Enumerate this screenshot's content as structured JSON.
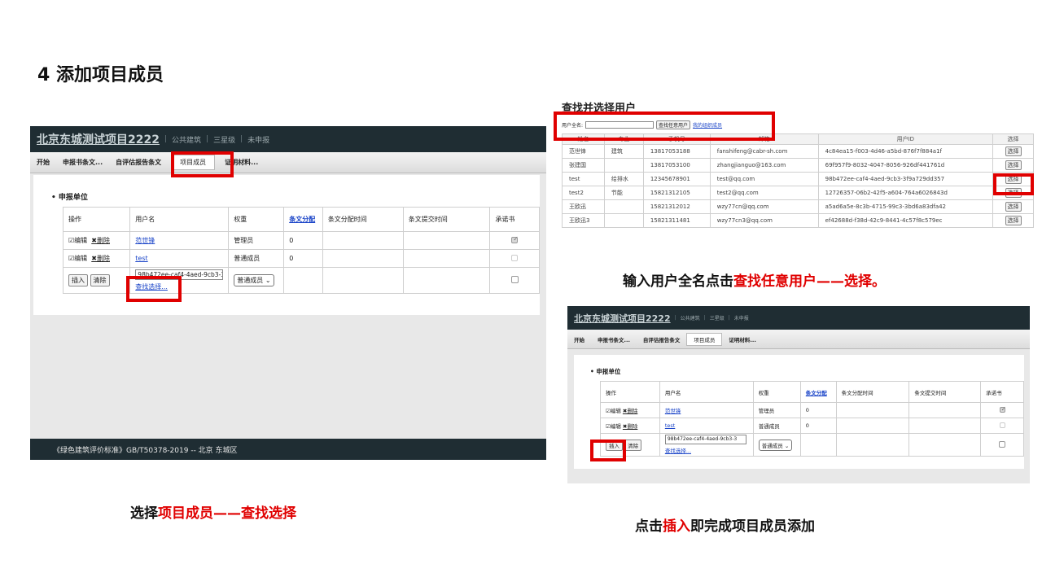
{
  "slide": {
    "title": "4 添加项目成员",
    "caption_left": {
      "p1": "选择",
      "p2": "项目成员——查找选择",
      "p3": ""
    },
    "caption_right_top": {
      "p1": "输入用户全名点击",
      "p2": "查找任意用户——选择。"
    },
    "caption_right_bottom": {
      "p1": "点击",
      "p2": "插入",
      "p3": "即完成项目成员添加"
    },
    "accent_color": "#e00000"
  },
  "app": {
    "project_name": "北京东城测试项目2222",
    "meta1": "公共建筑",
    "meta2": "三星级",
    "meta3": "未申报",
    "tabs": [
      "开始",
      "申报书条文...",
      "自评估报告条文",
      "项目成员",
      "证明材料..."
    ],
    "unit_label": "申报单位",
    "columns": [
      "操作",
      "用户名",
      "权重",
      "条文分配",
      "条文分配时间",
      "条文提交时间",
      "承诺书"
    ],
    "rows": [
      {
        "edit": "☑编辑",
        "del": "✖删除",
        "user": "范世锋",
        "role": "管理员",
        "count": "0"
      },
      {
        "edit": "☑编辑",
        "del": "✖删除",
        "user": "test",
        "role": "普通成员",
        "count": "0"
      }
    ],
    "insert_btn": "插入",
    "clear_btn": "清除",
    "user_id_value_left": "98b472ee-caf4-4aed-9cb3-3",
    "user_id_value_right": "98b472ee-caf4-4aed-9cb3-3",
    "find_link": "查找选择...",
    "role_select": "普通成员",
    "footer": "《绿色建筑评价标准》GB/T50378-2019 -- 北京 东城区"
  },
  "search": {
    "title": "查找并选择用户",
    "label": "用户全名:",
    "input_value": "",
    "find_btn": "查找任意用户",
    "my_org_link": "我的组织成员",
    "columns": [
      "姓名",
      "专业",
      "手机号",
      "邮箱",
      "用户ID",
      "选择"
    ],
    "rows": [
      {
        "name": "范世锋",
        "major": "建筑",
        "phone": "13817053188",
        "email": "fanshifeng@cabr-sh.com",
        "uid": "4c84ea15-f003-4d46-a5bd-876f7f884a1f",
        "pick": "选择"
      },
      {
        "name": "张建国",
        "major": "",
        "phone": "13817053100",
        "email": "zhangjianguo@163.com",
        "uid": "69f957f9-8032-4047-8056-926df441761d",
        "pick": "选择"
      },
      {
        "name": "test",
        "major": "给排水",
        "phone": "12345678901",
        "email": "test@qq.com",
        "uid": "98b472ee-caf4-4aed-9cb3-3f9a729dd357",
        "pick": "选择"
      },
      {
        "name": "test2",
        "major": "节能",
        "phone": "15821312105",
        "email": "test2@qq.com",
        "uid": "12726357-06b2-42f5-a604-764a6026843d",
        "pick": "选择"
      },
      {
        "name": "王欧迅",
        "major": "",
        "phone": "15821312012",
        "email": "wzy77cn@qq.com",
        "uid": "a5ad6a5e-8c3b-4715-99c3-3bd6a83dfa42",
        "pick": "选择"
      },
      {
        "name": "王欧迅3",
        "major": "",
        "phone": "15821311481",
        "email": "wzy77cn3@qq.com",
        "uid": "ef42688d-f38d-42c9-8441-4c57f8c579ec",
        "pick": "选择"
      }
    ]
  }
}
